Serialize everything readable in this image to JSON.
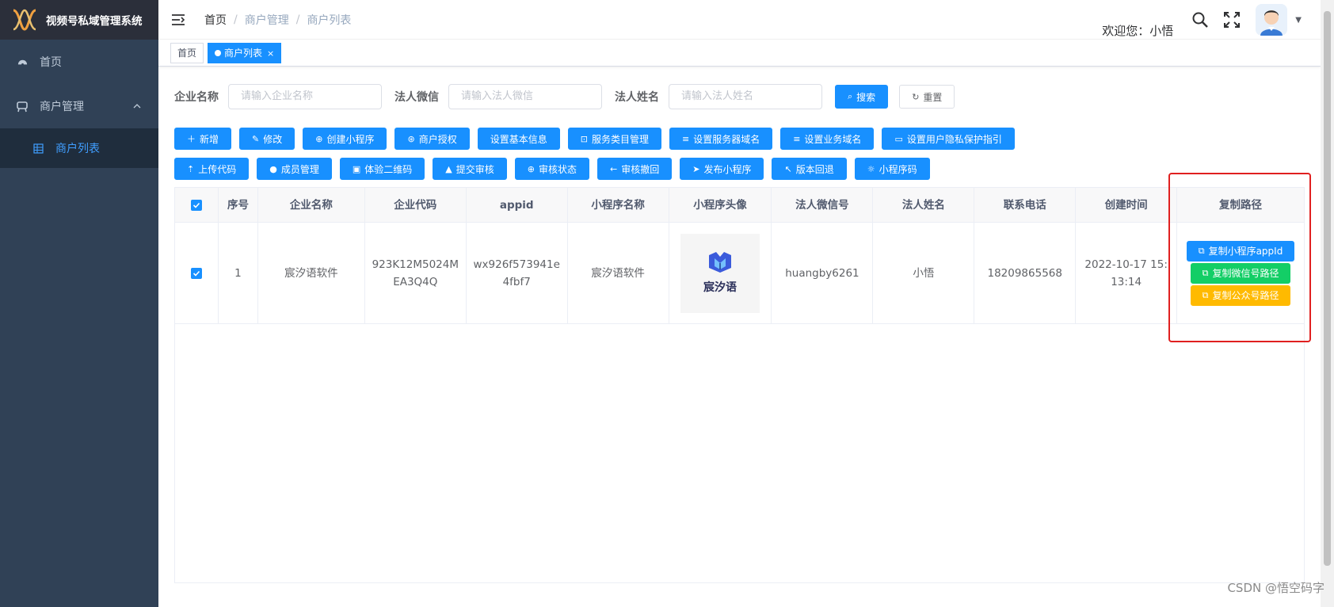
{
  "app": {
    "title": "视频号私域管理系统"
  },
  "sidebar": {
    "items": [
      {
        "label": "首页",
        "icon": "dashboard-icon"
      },
      {
        "label": "商户管理",
        "icon": "merchant-icon",
        "expanded": true
      }
    ],
    "subitems": [
      {
        "label": "商户列表",
        "icon": "table-icon",
        "active": true
      }
    ]
  },
  "header": {
    "breadcrumb": [
      "首页",
      "商户管理",
      "商户列表"
    ],
    "welcome": "欢迎您：小悟"
  },
  "tags": [
    {
      "label": "首页",
      "active": false
    },
    {
      "label": "商户列表",
      "active": true,
      "close": "×"
    }
  ],
  "search": {
    "company_label": "企业名称",
    "company_placeholder": "请输入企业名称",
    "wechat_label": "法人微信",
    "wechat_placeholder": "请输入法人微信",
    "name_label": "法人姓名",
    "name_placeholder": "请输入法人姓名",
    "search_btn": "搜索",
    "reset_btn": "重置"
  },
  "toolbar_row1": [
    "新增",
    "修改",
    "创建小程序",
    "商户授权",
    "设置基本信息",
    "服务类目管理",
    "设置服务器域名",
    "设置业务域名",
    "设置用户隐私保护指引"
  ],
  "toolbar_row2": [
    "上传代码",
    "成员管理",
    "体验二维码",
    "提交审核",
    "审核状态",
    "审核撤回",
    "发布小程序",
    "版本回退",
    "小程序码"
  ],
  "table": {
    "headers": [
      "序号",
      "企业名称",
      "企业代码",
      "appid",
      "小程序名称",
      "小程序头像",
      "法人微信号",
      "法人姓名",
      "联系电话",
      "创建时间",
      "复制路径"
    ],
    "rows": [
      {
        "index": "1",
        "company": "宸汐语软件",
        "code": "923K12M5024MEA3Q4Q",
        "appid": "wx926f573941e4fbf7",
        "mini_name": "宸汐语软件",
        "avatar_text": "宸汐语",
        "wechat": "huangby6261",
        "legal_name": "小悟",
        "phone": "18209865568",
        "created": "2022-10-17 15:13:14"
      }
    ],
    "copy_buttons": [
      "复制小程序appId",
      "复制微信号路径",
      "复制公众号路径"
    ]
  },
  "watermark": "CSDN @悟空码字",
  "colors": {
    "primary": "#1890ff",
    "sidebar": "#304156",
    "success": "#13ce66",
    "warning": "#ffba00",
    "highlight": "#e02020"
  }
}
